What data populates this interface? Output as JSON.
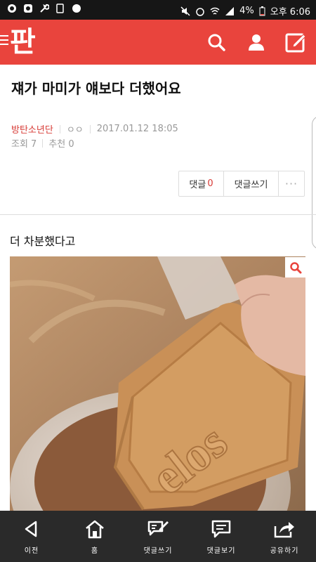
{
  "statusbar": {
    "battery": "4%",
    "time": "오후 6:06"
  },
  "appbar": {
    "logo_text": "판"
  },
  "post": {
    "title": "쟤가 마미가 얘보다 더했어요",
    "author": "방탄소년단",
    "author_extra": "ㅇㅇ",
    "datetime": "2017.01.12 18:05",
    "views": "조회 7",
    "recommend": "추천 0",
    "body_text": "더 차분했다고"
  },
  "actions": {
    "comment_label": "댓글",
    "comment_count": "0",
    "write_label": "댓글쓰기",
    "more_label": "···"
  },
  "bottom_nav": [
    {
      "label": "이전",
      "icon": "back-icon"
    },
    {
      "label": "홈",
      "icon": "home-icon"
    },
    {
      "label": "댓글쓰기",
      "icon": "write-comment-icon"
    },
    {
      "label": "댓글보기",
      "icon": "view-comment-icon"
    },
    {
      "label": "공유하기",
      "icon": "share-icon"
    }
  ],
  "colors": {
    "brand": "#e9443d",
    "accent_text": "#d73a35",
    "bottom_bar": "#2a2a2a"
  }
}
